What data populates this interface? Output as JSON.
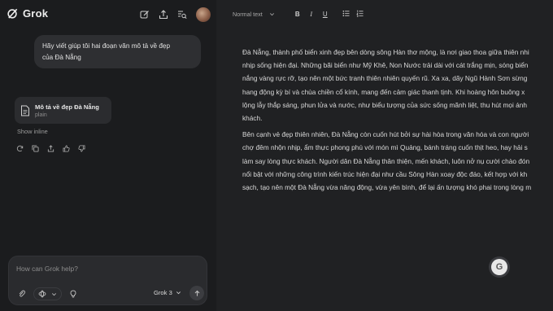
{
  "app": {
    "name": "Grok"
  },
  "topbar": {
    "icons": [
      "edit-icon",
      "share-icon",
      "search-history-icon",
      "avatar"
    ]
  },
  "chat": {
    "user_message": "Hãy viết giúp tôi hai đoạn văn mô tả về đẹp của Đà Nẵng",
    "user_message_line1": "Hãy viết giúp tôi hai đoạn văn mô tả về đẹp",
    "user_message_line2": "của Đà Nẵng",
    "artifact": {
      "title": "Mô tả về đẹp Đà Nẵng",
      "subtitle": "plain"
    },
    "show_inline_label": "Show inline",
    "actions": [
      "regenerate-icon",
      "copy-icon",
      "share-icon",
      "like-icon",
      "dislike-icon"
    ]
  },
  "composer": {
    "placeholder": "How can Grok help?",
    "model_label": "Grok 3"
  },
  "editor": {
    "style_label": "Normal text",
    "bold_label": "B",
    "italic_label": "I",
    "underline_label": "U",
    "paragraph1_lines": [
      "Đà Nẵng, thành phố biển xinh đẹp bên dòng sông Hàn thơ mộng, là nơi giao thoa giữa thiên nhi",
      "nhịp sống hiện đại. Những bãi biển như Mỹ Khê, Non Nước trải dài với cát trắng mịn, sóng biển",
      "nắng vàng rực rỡ, tạo nên một bức tranh thiên nhiên quyến rũ. Xa xa, dãy Ngũ Hành Sơn sừng",
      "hang động kỳ bí và chùa chiền cổ kính, mang đến cảm giác thanh tịnh. Khi hoàng hôn buông x",
      "lộng lẫy thắp sáng, phun lửa và nước, như biểu tượng của sức sống mãnh liệt, thu hút mọi ánh",
      "khách."
    ],
    "paragraph2_lines": [
      "Bên cạnh vẻ đẹp thiên nhiên, Đà Nẵng còn cuốn hút bởi sự hài hòa trong văn hóa và con người",
      "chợ đêm nhộn nhịp, ẩm thực phong phú với món mì Quảng, bánh tráng cuốn thịt heo, hay hải s",
      "làm say lòng thực khách. Người dân Đà Nẵng thân thiện, mến khách, luôn nở nụ cười chào đón",
      "nổi bật với những công trình kiến trúc hiện đại như cầu Sông Hàn xoay độc đáo, kết hợp với kh",
      "sạch, tạo nên một Đà Nẵng vừa năng động, vừa yên bình, để lại ấn tượng khó phai trong lòng m"
    ]
  },
  "grammar_badge": {
    "letter": "G"
  }
}
